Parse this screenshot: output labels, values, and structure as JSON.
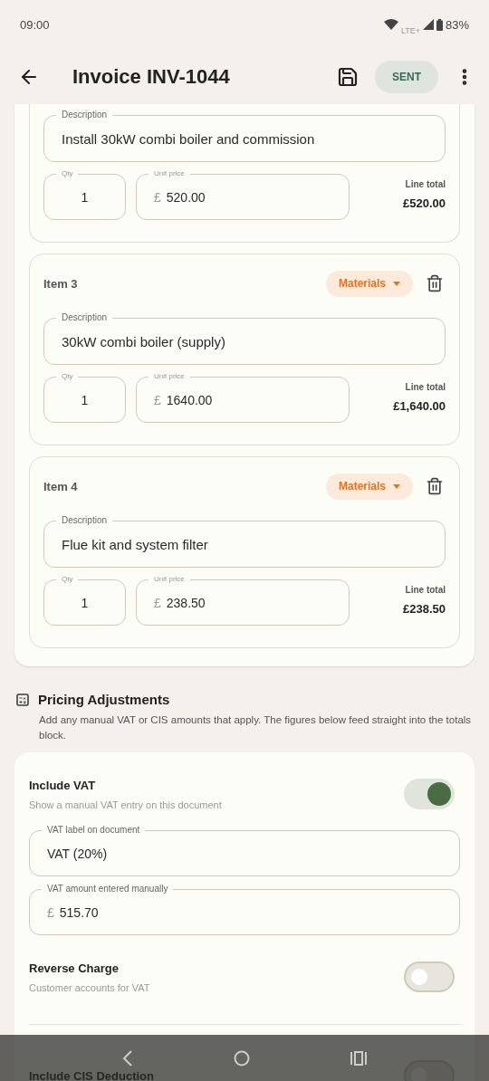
{
  "status_bar": {
    "time": "09:00",
    "network": "LTE+",
    "battery": "83%"
  },
  "app_bar": {
    "title": "Invoice INV-1044",
    "status": "SENT"
  },
  "items": [
    {
      "description": {
        "label": "Description",
        "value": "Install 30kW combi boiler and commission"
      },
      "qty": {
        "label": "Qty",
        "value": "1"
      },
      "unit_price": {
        "label": "Unit price",
        "prefix": "£",
        "value": "520.00"
      },
      "line_total": {
        "label": "Line total",
        "value": "£520.00"
      }
    },
    {
      "label": "Item 3",
      "category": "Materials",
      "description": {
        "label": "Description",
        "value": "30kW combi boiler (supply)"
      },
      "qty": {
        "label": "Qty",
        "value": "1"
      },
      "unit_price": {
        "label": "Unit price",
        "prefix": "£",
        "value": "1640.00"
      },
      "line_total": {
        "label": "Line total",
        "value": "£1,640.00"
      }
    },
    {
      "label": "Item 4",
      "category": "Materials",
      "description": {
        "label": "Description",
        "value": "Flue kit and system filter"
      },
      "qty": {
        "label": "Qty",
        "value": "1"
      },
      "unit_price": {
        "label": "Unit price",
        "prefix": "£",
        "value": "238.50"
      },
      "line_total": {
        "label": "Line total",
        "value": "£238.50"
      }
    }
  ],
  "pricing": {
    "title": "Pricing Adjustments",
    "description": "Add any manual VAT or CIS amounts that apply. The figures below feed straight into the totals block.",
    "settings": [
      {
        "title": "Include VAT",
        "subtitle": "Show a manual VAT entry on this document",
        "on": true,
        "fields": [
          {
            "label": "VAT label on document",
            "value": "VAT (20%)"
          },
          {
            "label": "VAT amount entered manually",
            "prefix": "£",
            "value": "515.70"
          }
        ]
      },
      {
        "title": "Reverse Charge",
        "subtitle": "Customer accounts for VAT",
        "on": false
      },
      {
        "title": "Include CIS Deduction",
        "on": false
      }
    ]
  }
}
